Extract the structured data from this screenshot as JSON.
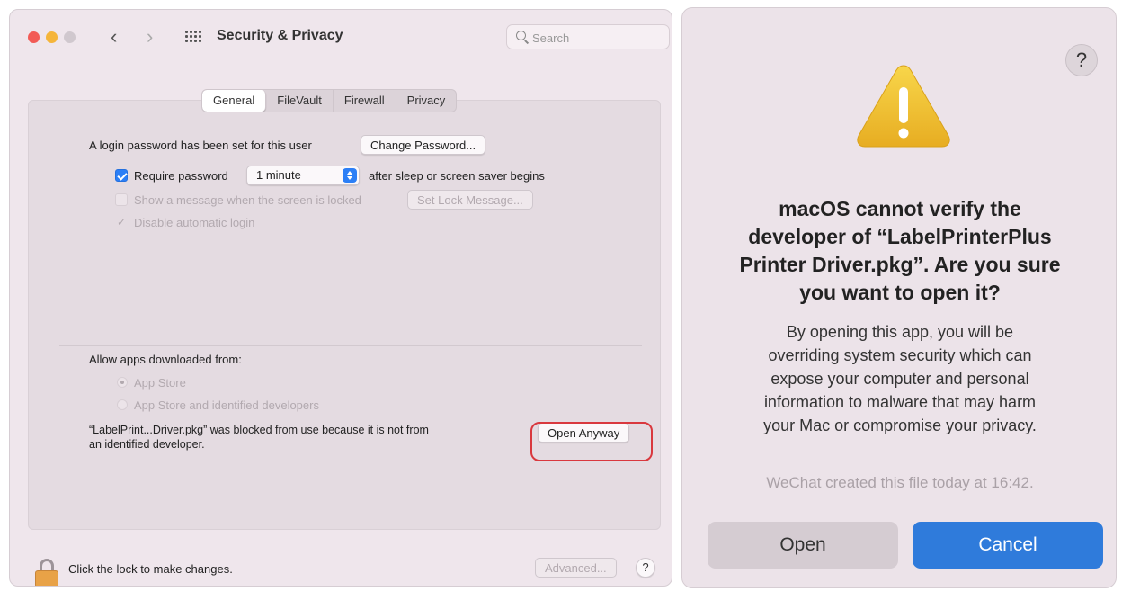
{
  "window": {
    "title": "Security & Privacy",
    "search": {
      "placeholder": "Search"
    },
    "tabs": [
      {
        "label": "General",
        "active": true
      },
      {
        "label": "FileVault",
        "active": false
      },
      {
        "label": "Firewall",
        "active": false
      },
      {
        "label": "Privacy",
        "active": false
      }
    ],
    "general": {
      "login_text": "A login password has been set for this user",
      "change_password_label": "Change Password...",
      "require_password": {
        "label": "Require password",
        "checked": true
      },
      "require_interval": "1 minute",
      "after_sleep_text": "after sleep or screen saver begins",
      "show_message": {
        "label": "Show a message when the screen is locked",
        "checked": false,
        "enabled": false
      },
      "set_lock_message_label": "Set Lock Message...",
      "disable_auto_login": {
        "label": "Disable automatic login",
        "checked": true,
        "enabled": false
      }
    },
    "allow_apps": {
      "heading": "Allow apps downloaded from:",
      "options": [
        {
          "label": "App Store",
          "selected": true
        },
        {
          "label": "App Store and identified developers",
          "selected": false
        }
      ],
      "blocked_text_line1": "“LabelPrint...Driver.pkg” was blocked from use because it is not from",
      "blocked_text_line2": "an identified developer.",
      "open_anyway_label": "Open Anyway"
    },
    "footer": {
      "lock_text": "Click the lock to make changes.",
      "advanced_label": "Advanced...",
      "help_label": "?"
    }
  },
  "dialog": {
    "help_label": "?",
    "title": "macOS cannot verify the\ndeveloper of “LabelPrinterPlus\nPrinter Driver.pkg”. Are you sure\nyou want to open it?",
    "body": "By opening this app, you will be\noverriding system security which can\nexpose your computer and personal\ninformation to malware that may harm\nyour Mac or compromise your privacy.",
    "note": "WeChat created this file today at 16:42.",
    "open_label": "Open",
    "cancel_label": "Cancel"
  },
  "colors": {
    "accent": "#2c7ff6",
    "cancel_button": "#2f7bdb",
    "highlight_ring": "#d9383e",
    "warning": "#f2c12e"
  }
}
